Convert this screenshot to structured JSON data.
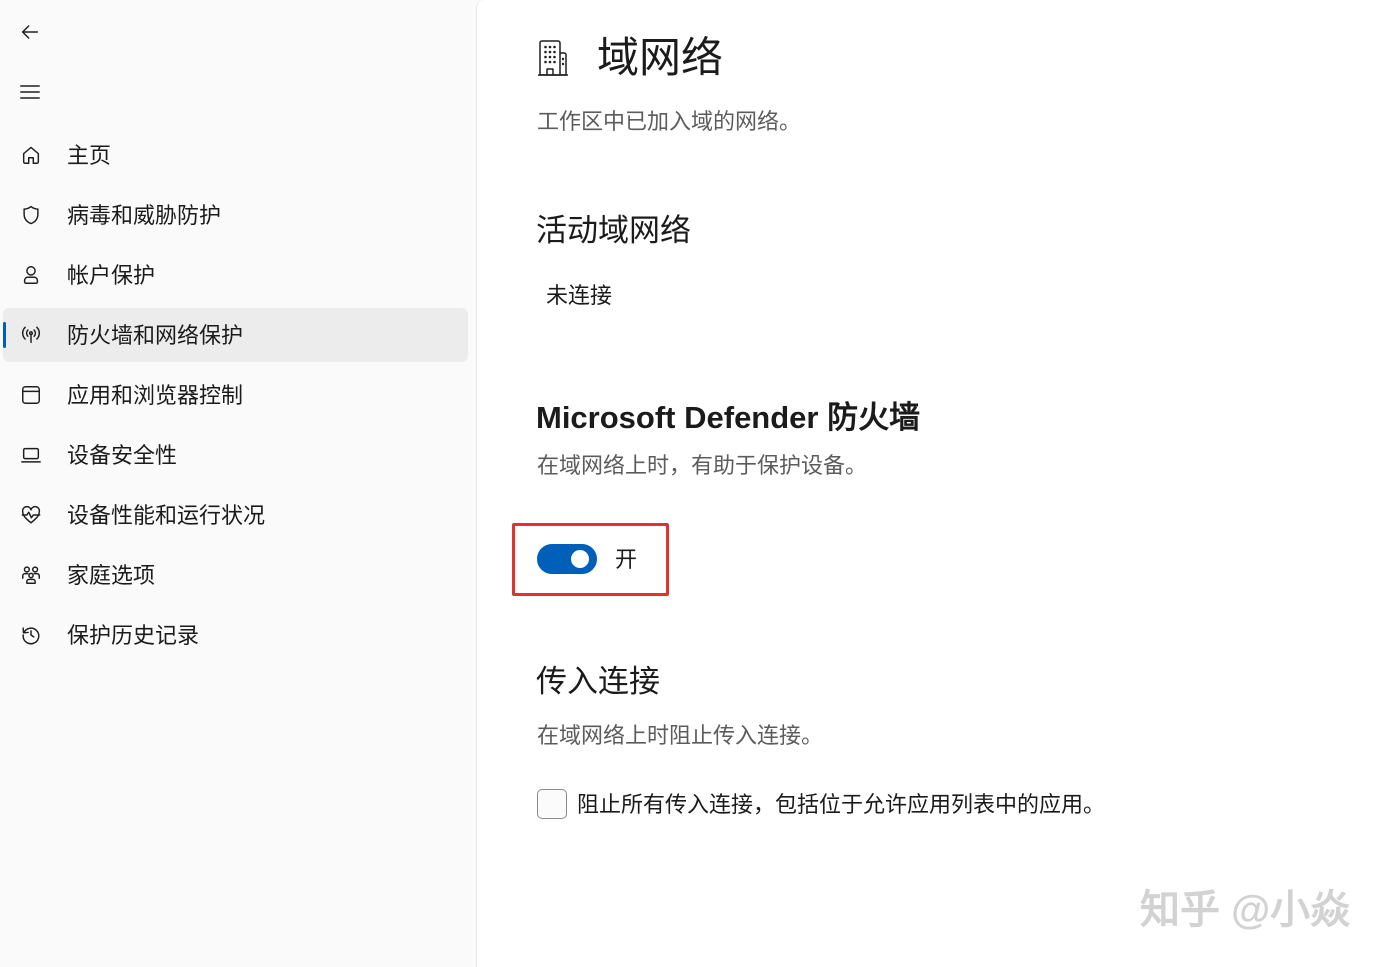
{
  "nav": {
    "back_icon": "back-arrow-icon",
    "menu_icon": "hamburger-menu-icon",
    "selected_index": 3,
    "items": [
      {
        "label": "主页",
        "icon": "home-icon"
      },
      {
        "label": "病毒和威胁防护",
        "icon": "shield-icon"
      },
      {
        "label": "帐户保护",
        "icon": "person-icon"
      },
      {
        "label": "防火墙和网络保护",
        "icon": "broadcast-antenna-icon"
      },
      {
        "label": "应用和浏览器控制",
        "icon": "browser-window-icon"
      },
      {
        "label": "设备安全性",
        "icon": "laptop-icon"
      },
      {
        "label": "设备性能和运行状况",
        "icon": "heart-pulse-icon"
      },
      {
        "label": "家庭选项",
        "icon": "family-icon"
      },
      {
        "label": "保护历史记录",
        "icon": "history-icon"
      }
    ]
  },
  "content": {
    "title_icon": "building-icon",
    "title": "域网络",
    "subtitle": "工作区中已加入域的网络。",
    "active_network": {
      "heading": "活动域网络",
      "value": "未连接"
    },
    "firewall": {
      "heading": "Microsoft Defender 防火墙",
      "description": "在域网络上时，有助于保护设备。",
      "toggle_label": "开",
      "toggle_on": true
    },
    "incoming": {
      "heading": "传入连接",
      "description": "在域网络上时阻止传入连接。",
      "checkbox_label": "阻止所有传入连接，包括位于允许应用列表中的应用。",
      "checked": false
    }
  },
  "watermark": "知乎 @小焱",
  "colors": {
    "accent": "#005fb8",
    "highlight": "#e3312d"
  }
}
